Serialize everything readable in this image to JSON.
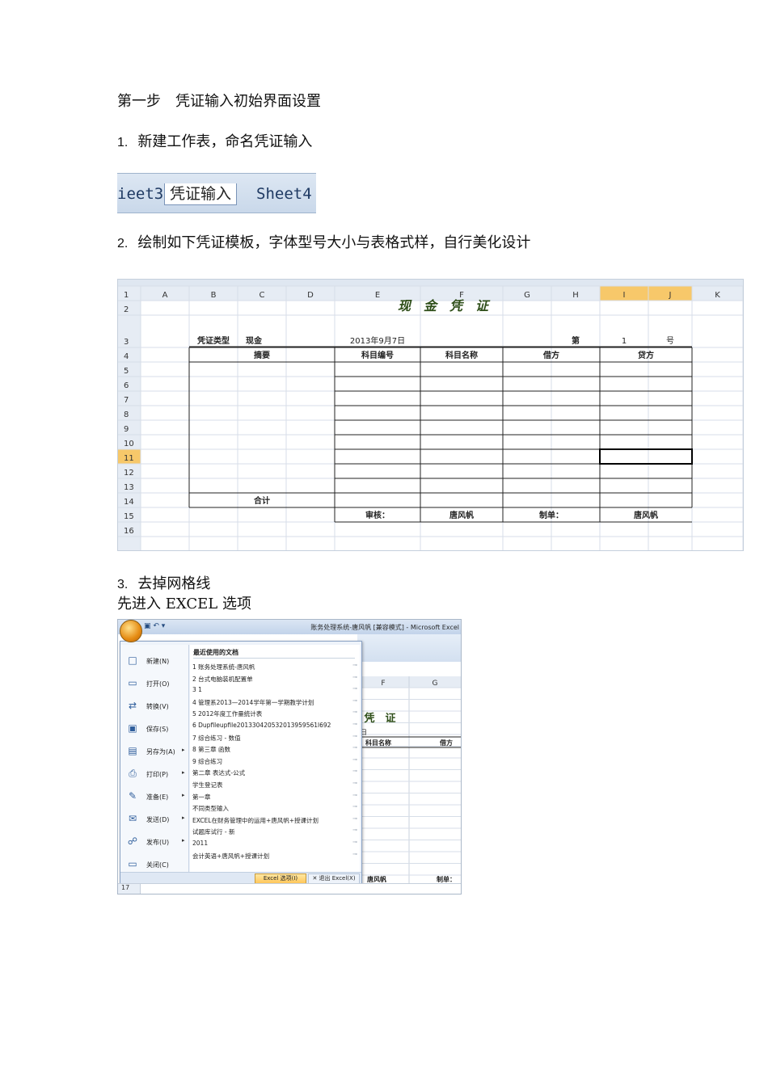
{
  "heading": "第一步　凭证输入初始界面设置",
  "step1": {
    "num": "1.",
    "text": "新建工作表，命名凭证输入"
  },
  "sheet_tabs": [
    "ieet3",
    "凭证输入",
    "Sheet4"
  ],
  "step2": {
    "num": "2.",
    "text": "绘制如下凭证模板，字体型号大小与表格式样，自行美化设计"
  },
  "spreadsheet": {
    "columns": [
      "A",
      "B",
      "C",
      "D",
      "E",
      "F",
      "G",
      "H",
      "I",
      "J",
      "K"
    ],
    "rows": [
      "1",
      "2",
      "3",
      "4",
      "5",
      "6",
      "7",
      "8",
      "9",
      "10",
      "11",
      "12",
      "13",
      "14",
      "15",
      "16"
    ],
    "voucher_title": "现　金　凭　证",
    "voucher_type_label": "凭证类型",
    "voucher_type_value": "现金",
    "date": "2013年9月7日",
    "no_prefix": "第",
    "no_value": "1",
    "no_suffix": "号",
    "header_summary": "摘要",
    "header_code": "科目编号",
    "header_name": "科目名称",
    "header_debit": "借方",
    "header_credit": "贷方",
    "total_label": "合计",
    "reviewer_label": "审核：",
    "reviewer_name": "唐风帆",
    "maker_label": "制单：",
    "maker_name": "唐风帆"
  },
  "step3": {
    "num": "3.",
    "text": "去掉网格线"
  },
  "step3_note": "先进入 EXCEL 选项",
  "excel_window": {
    "title": "账务处理系统-唐风帆 [兼容模式] - Microsoft Excel",
    "menu_items": [
      {
        "label": "新建(N)",
        "icon": "new-document-icon",
        "glyph": "□",
        "arrow": false
      },
      {
        "label": "打开(O)",
        "icon": "open-folder-icon",
        "glyph": "▭",
        "arrow": false
      },
      {
        "label": "转换(V)",
        "icon": "convert-icon",
        "glyph": "⇄",
        "arrow": false
      },
      {
        "label": "保存(S)",
        "icon": "save-disk-icon",
        "glyph": "▣",
        "arrow": false
      },
      {
        "label": "另存为(A)",
        "icon": "save-as-icon",
        "glyph": "▤",
        "arrow": true
      },
      {
        "label": "打印(P)",
        "icon": "print-icon",
        "glyph": "⎙",
        "arrow": true
      },
      {
        "label": "准备(E)",
        "icon": "prepare-icon",
        "glyph": "✎",
        "arrow": true
      },
      {
        "label": "发送(D)",
        "icon": "send-icon",
        "glyph": "✉",
        "arrow": true
      },
      {
        "label": "发布(U)",
        "icon": "publish-icon",
        "glyph": "☍",
        "arrow": true
      },
      {
        "label": "关闭(C)",
        "icon": "close-folder-icon",
        "glyph": "▭",
        "arrow": false
      }
    ],
    "recent_title": "最近使用的文档",
    "recent_docs": [
      "1 账务处理系统-唐风帆",
      "2 台式电脑装机配置单",
      "3 1",
      "4 管理系2013—2014学年第一学期教学计划",
      "5 2012年度工作量统计表",
      "6 Dupfileupfile201330420532013959561l692",
      "7 综合练习 - 数值",
      "8 第三章 函数",
      "9 综合练习",
      "第二章 表达式-公式",
      "学生登记表",
      "第一章",
      "不同类型输入",
      "EXCEL在财务管理中的运用+唐风帆+授课计划",
      "试题库试行 - 新",
      "2011",
      "会计英语+唐风帆+授课计划"
    ],
    "options_button": "Excel 选项(I)",
    "exit_button": "✕ 退出 Excel(X)",
    "bg_columns": [
      "F",
      "G"
    ],
    "bg_title": "凭　证",
    "bg_fragment": "日",
    "bg_header_name": "科目名称",
    "bg_header_debit": "借方",
    "bg_signer": "唐风帆",
    "bg_maker": "制单：",
    "row_17": "17"
  }
}
